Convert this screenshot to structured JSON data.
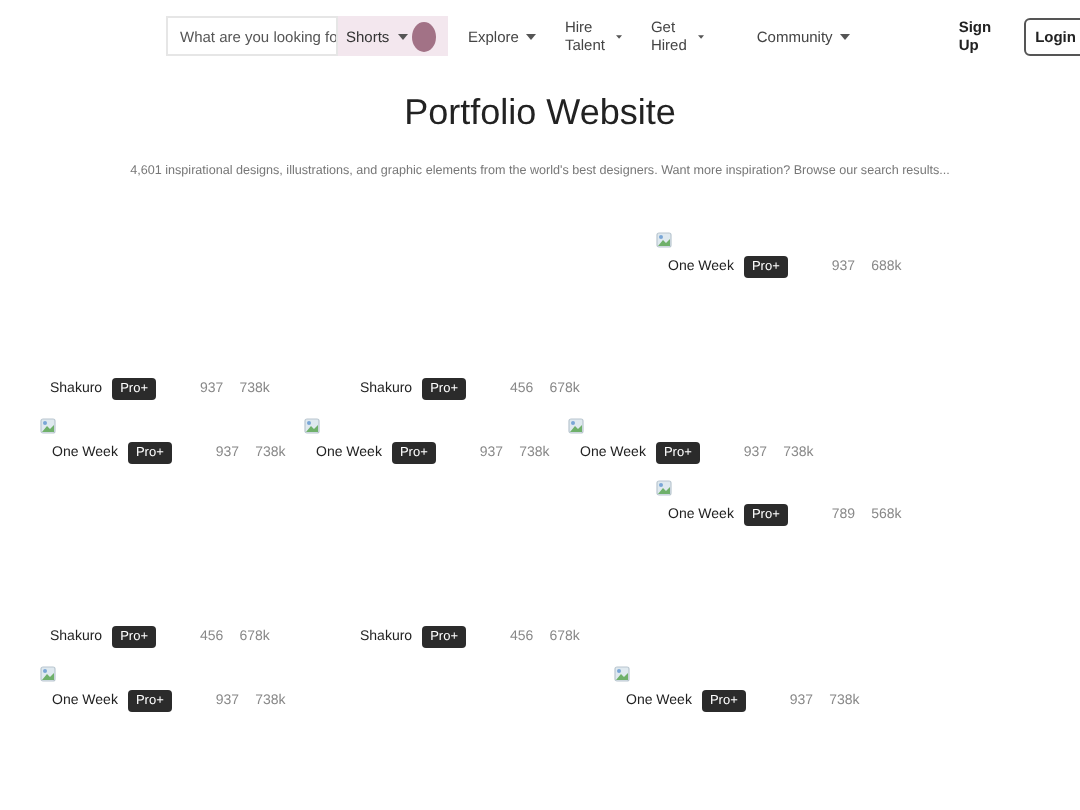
{
  "header": {
    "search": {
      "placeholder": "What are you looking fo"
    },
    "search_type": "Shorts",
    "nav": [
      "Explore",
      "Hire Talent",
      "Get Hired",
      "Community"
    ],
    "sign_up": "Sign Up",
    "login": "Login"
  },
  "title": "Portfolio Website",
  "description": "4,601 inspirational designs, illustrations, and graphic elements from the world's best designers. Want more inspiration? Browse our search results...",
  "shot_rows": [
    [
      {
        "kind": "image",
        "designer": "One Week",
        "badge": "Pro+",
        "likes": "937",
        "views": "688k"
      }
    ],
    [
      {
        "kind": "text",
        "designer": "Shakuro",
        "badge": "Pro+",
        "likes": "937",
        "views": "738k"
      },
      {
        "kind": "text",
        "designer": "Shakuro",
        "badge": "Pro+",
        "likes": "456",
        "views": "678k"
      }
    ],
    [
      {
        "kind": "image",
        "designer": "One Week",
        "badge": "Pro+",
        "likes": "937",
        "views": "738k"
      },
      {
        "kind": "image",
        "designer": "One Week",
        "badge": "Pro+",
        "likes": "937",
        "views": "738k"
      },
      {
        "kind": "image",
        "designer": "One Week",
        "badge": "Pro+",
        "likes": "937",
        "views": "738k"
      }
    ],
    [
      {
        "kind": "image",
        "designer": "One Week",
        "badge": "Pro+",
        "likes": "789",
        "views": "568k"
      }
    ],
    [
      {
        "kind": "text",
        "designer": "Shakuro",
        "badge": "Pro+",
        "likes": "456",
        "views": "678k"
      },
      {
        "kind": "text",
        "designer": "Shakuro",
        "badge": "Pro+",
        "likes": "456",
        "views": "678k"
      }
    ],
    [
      {
        "kind": "image",
        "designer": "One Week",
        "badge": "Pro+",
        "likes": "937",
        "views": "738k"
      },
      {
        "kind": "image",
        "designer": "One Week",
        "badge": "Pro+",
        "likes": "937",
        "views": "738k"
      }
    ]
  ]
}
